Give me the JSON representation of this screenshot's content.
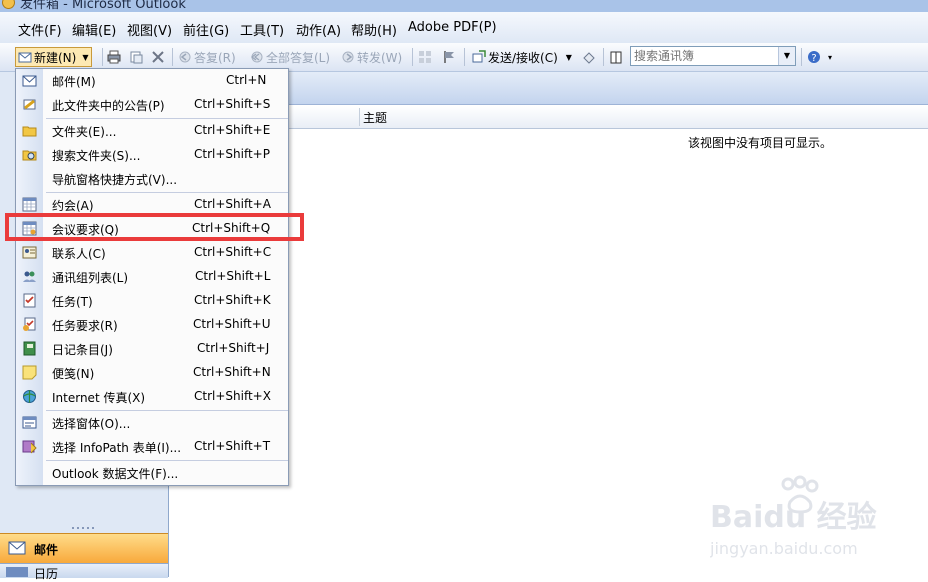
{
  "window": {
    "title": "发件箱 - Microsoft Outlook"
  },
  "menubar": [
    "文件(F)",
    "编辑(E)",
    "视图(V)",
    "前往(G)",
    "工具(T)",
    "动作(A)",
    "帮助(H)",
    "Adobe PDF(P)"
  ],
  "toolbar": {
    "new_label": "新建(N)",
    "reply_label": "答复(R)",
    "reply_all_label": "全部答复(L)",
    "forward_label": "转发(W)",
    "send_receive_label": "发送/接收(C)",
    "search_placeholder": "搜索通讯簿"
  },
  "new_menu": {
    "items": [
      {
        "label": "邮件(M)",
        "shortcut": "Ctrl+N",
        "icon": "mail-icon"
      },
      {
        "label": "此文件夹中的公告(P)",
        "shortcut": "Ctrl+Shift+S",
        "icon": "post-icon"
      },
      {
        "label": "文件夹(E)...",
        "shortcut": "Ctrl+Shift+E",
        "icon": "folder-icon"
      },
      {
        "label": "搜索文件夹(S)...",
        "shortcut": "Ctrl+Shift+P",
        "icon": "search-folder-icon"
      },
      {
        "label": "导航窗格快捷方式(V)...",
        "shortcut": "",
        "icon": ""
      },
      {
        "label": "约会(A)",
        "shortcut": "Ctrl+Shift+A",
        "icon": "appointment-icon"
      },
      {
        "label": "会议要求(Q)",
        "shortcut": "Ctrl+Shift+Q",
        "icon": "meeting-request-icon"
      },
      {
        "label": "联系人(C)",
        "shortcut": "Ctrl+Shift+C",
        "icon": "contact-icon"
      },
      {
        "label": "通讯组列表(L)",
        "shortcut": "Ctrl+Shift+L",
        "icon": "distribution-list-icon"
      },
      {
        "label": "任务(T)",
        "shortcut": "Ctrl+Shift+K",
        "icon": "task-icon"
      },
      {
        "label": "任务要求(R)",
        "shortcut": "Ctrl+Shift+U",
        "icon": "task-request-icon"
      },
      {
        "label": "日记条目(J)",
        "shortcut": "Ctrl+Shift+J",
        "icon": "journal-icon"
      },
      {
        "label": "便笺(N)",
        "shortcut": "Ctrl+Shift+N",
        "icon": "note-icon"
      },
      {
        "label": "Internet 传真(X)",
        "shortcut": "Ctrl+Shift+X",
        "icon": "fax-icon"
      },
      {
        "label": "选择窗体(O)...",
        "shortcut": "",
        "icon": "form-icon"
      },
      {
        "label": "选择 InfoPath 表单(I)...",
        "shortcut": "Ctrl+Shift+T",
        "icon": "infopath-icon"
      },
      {
        "label": "Outlook 数据文件(F)...",
        "shortcut": "",
        "icon": ""
      }
    ]
  },
  "list": {
    "column_subject": "主题",
    "empty_message": "该视图中没有项目可显示。"
  },
  "nav": {
    "mail_label": "邮件",
    "calendar_label": "日历"
  },
  "watermark": {
    "brand": "Baidu 经验",
    "url": "jingyan.baidu.com"
  },
  "colors": {
    "highlight": "#ea3b3b",
    "active_nav": "#f8a93b"
  }
}
